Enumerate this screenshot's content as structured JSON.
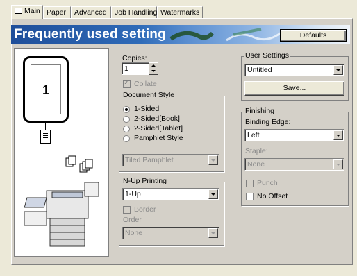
{
  "tabs": [
    {
      "label": "Main",
      "active": true
    },
    {
      "label": "Paper",
      "active": false
    },
    {
      "label": "Advanced",
      "active": false
    },
    {
      "label": "Job Handling",
      "active": false
    },
    {
      "label": "Watermarks",
      "active": false
    }
  ],
  "banner": {
    "title": "Frequently used setting",
    "defaults_label": "Defaults"
  },
  "preview": {
    "page_number": "1"
  },
  "copies": {
    "label": "Copies:",
    "value": "1"
  },
  "collate": {
    "label": "Collate",
    "checked": true,
    "enabled": false
  },
  "document_style": {
    "label": "Document Style",
    "options": [
      "1-Sided",
      "2-Sided[Book]",
      "2-Sided[Tablet]",
      "Pamphlet Style"
    ],
    "selected": "1-Sided",
    "pamphlet_select": "Tiled Pamphlet"
  },
  "nup": {
    "label": "N-Up Printing",
    "value": "1-Up",
    "border_label": "Border",
    "order_label": "Order",
    "order_value": "None"
  },
  "user_settings": {
    "label": "User Settings",
    "value": "Untitled",
    "save_label": "Save..."
  },
  "finishing": {
    "label": "Finishing",
    "binding_label": "Binding Edge:",
    "binding_value": "Left",
    "staple_label": "Staple:",
    "staple_value": "None",
    "punch_label": "Punch",
    "no_offset_label": "No Offset"
  },
  "colors": {
    "banner_start": "#1f4e9a",
    "dialog_bg": "#d4d0c8"
  }
}
